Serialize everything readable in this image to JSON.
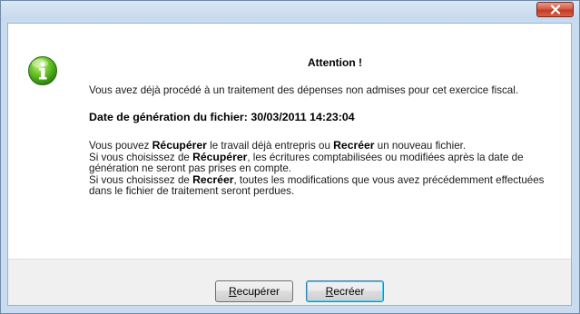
{
  "titlebar": {
    "close_icon": "close-icon"
  },
  "dialog": {
    "icon": "info-icon",
    "heading": "Attention !",
    "message_line1": "Vous avez déjà procédé à un traitement des dépenses non admises pour cet exercice fiscal.",
    "date_label": "Date de génération du fichier: 30/03/2011 14:23:04",
    "p1_a": "Vous pouvez ",
    "p1_b": "Récupérer",
    "p1_c": " le travail déjà entrepris ou ",
    "p1_d": "Recréer",
    "p1_e": " un nouveau fichier.",
    "p2_a": "Si vous choisissez de ",
    "p2_b": "Récupérer",
    "p2_c": ", les écritures comptabilisées ou modifiées après la date de génération ne seront pas prises en compte.",
    "p3_a": "Si vous choisissez de ",
    "p3_b": "Recréer",
    "p3_c": ", toutes les modifications que vous avez précédemment effectuées dans le fichier de traitement seront perdues."
  },
  "buttons": {
    "recuperer_mnemonic": "R",
    "recuperer_rest": "ecupérer",
    "recreer_mnemonic": "R",
    "recreer_rest": "ecréer"
  },
  "colors": {
    "window_frame": "#c9dcef",
    "close_button": "#c43b22",
    "info_icon": "#4caf1f"
  }
}
